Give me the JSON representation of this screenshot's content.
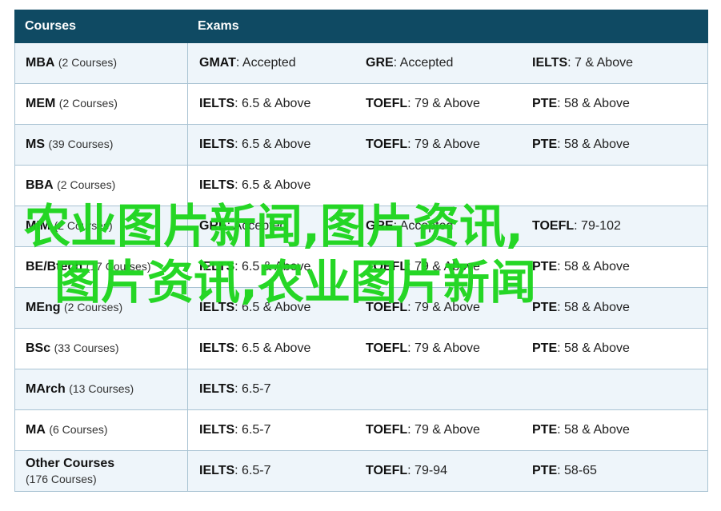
{
  "header": {
    "courses_label": "Courses",
    "exams_label": "Exams"
  },
  "rows": [
    {
      "name": "MBA",
      "count": "(2 Courses)",
      "exams": [
        {
          "name": "GMAT",
          "value": ": Accepted"
        },
        {
          "name": "GRE",
          "value": ": Accepted"
        },
        {
          "name": "IELTS",
          "value": ": 7 & Above"
        }
      ]
    },
    {
      "name": "MEM",
      "count": "(2 Courses)",
      "exams": [
        {
          "name": "IELTS",
          "value": ": 6.5 & Above"
        },
        {
          "name": "TOEFL",
          "value": ": 79 & Above"
        },
        {
          "name": "PTE",
          "value": ": 58 & Above"
        }
      ]
    },
    {
      "name": "MS",
      "count": "(39 Courses)",
      "exams": [
        {
          "name": "IELTS",
          "value": ": 6.5 & Above"
        },
        {
          "name": "TOEFL",
          "value": ": 79 & Above"
        },
        {
          "name": "PTE",
          "value": ": 58 & Above"
        }
      ]
    },
    {
      "name": "BBA",
      "count": "(2 Courses)",
      "exams": [
        {
          "name": "IELTS",
          "value": ": 6.5 & Above"
        }
      ]
    },
    {
      "name": "MIM",
      "count": "(2 Courses)",
      "exams": [
        {
          "name": "GRE",
          "value": ": Accepted"
        },
        {
          "name": "GRE",
          "value": ": Accepted"
        },
        {
          "name": "TOEFL",
          "value": ": 79-102"
        }
      ]
    },
    {
      "name": "BE/Btech",
      "count": "(17 Courses)",
      "exams": [
        {
          "name": "IELTS",
          "value": ": 6.5 & Above"
        },
        {
          "name": "TOEFL",
          "value": ": 79 & Above"
        },
        {
          "name": "PTE",
          "value": ": 58 & Above"
        }
      ]
    },
    {
      "name": "MEng",
      "count": "(2 Courses)",
      "exams": [
        {
          "name": "IELTS",
          "value": ": 6.5 & Above"
        },
        {
          "name": "TOEFL",
          "value": ": 79 & Above"
        },
        {
          "name": "PTE",
          "value": ": 58 & Above"
        }
      ]
    },
    {
      "name": "BSc",
      "count": "(33 Courses)",
      "exams": [
        {
          "name": "IELTS",
          "value": ": 6.5 & Above"
        },
        {
          "name": "TOEFL",
          "value": ": 79 & Above"
        },
        {
          "name": "PTE",
          "value": ": 58 & Above"
        }
      ]
    },
    {
      "name": "MArch",
      "count": "(13 Courses)",
      "exams": [
        {
          "name": "IELTS",
          "value": ": 6.5-7"
        }
      ]
    },
    {
      "name": "MA",
      "count": "(6 Courses)",
      "exams": [
        {
          "name": "IELTS",
          "value": ": 6.5-7"
        },
        {
          "name": "TOEFL",
          "value": ": 79 & Above"
        },
        {
          "name": "PTE",
          "value": ": 58 & Above"
        }
      ]
    },
    {
      "name": "Other Courses",
      "count": "(176 Courses)",
      "exams": [
        {
          "name": "IELTS",
          "value": ": 6.5-7"
        },
        {
          "name": "TOEFL",
          "value": ": 79-94"
        },
        {
          "name": "PTE",
          "value": ": 58-65"
        }
      ]
    }
  ],
  "watermark": {
    "line1": "农业图片新闻,图片资讯,",
    "line2": "图片资讯,农业图片新闻"
  },
  "colors": {
    "header_bg": "#0f4a63",
    "row_alt": "#eef5fa",
    "watermark": "#1fd61f"
  }
}
